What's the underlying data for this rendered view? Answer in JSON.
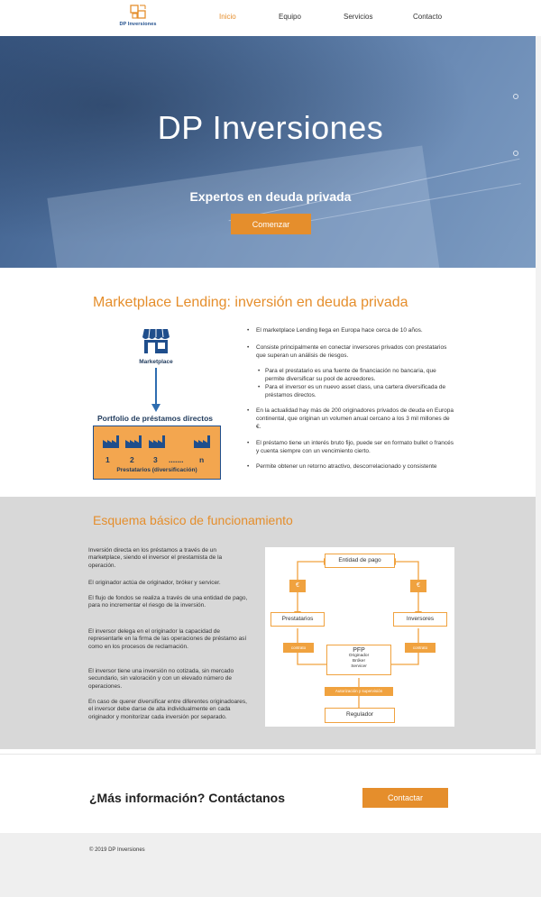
{
  "header": {
    "logo_text": "DP Inversiones",
    "nav": [
      "Inicio",
      "Equipo",
      "Servicios",
      "Contacto"
    ]
  },
  "hero": {
    "title": "DP Inversiones",
    "subtitle": "Expertos en deuda privada",
    "cta": "Comenzar"
  },
  "section1": {
    "title": "Marketplace Lending: inversión en deuda privada",
    "marketplace_label": "Marketplace",
    "portfolio_title": "Portfolio de préstamos directos",
    "portfolio_numbers": [
      "1",
      "2",
      "3",
      ".......",
      "n"
    ],
    "portfolio_caption": "Prestatarios (diversificación)",
    "bullets": [
      "El marketplace Lending llega en Europa hace cerca de 10 años.",
      "Consiste principalmente en conectar inversores privados con prestatarios que superan un análisis de riesgos.",
      "Para el prestatario es una fuente de financiación no bancaria, que permite diversificar su pool de acreedores.",
      "Para el inversor es un nuevo asset class, una cartera diversificada de préstamos directos.",
      "En la actualidad hay más de 200 originadores privados de deuda en Europa continental, que originan un volumen anual cercano a los 3 mil millones de €.",
      "El préstamo tiene un interés bruto fijo, puede ser en formato bullet o francés y cuenta siempre con un vencimiento cierto.",
      "Permite obtener un retorno atractivo, descorrelacionado y consistente"
    ]
  },
  "section2": {
    "title": "Esquema básico de funcionamiento",
    "paragraphs": [
      "Inversión directa en los préstamos a través de un marketplace, siendo el inversor el prestamista de la operación.",
      "El originador actúa de originador, bróker y servicer.",
      "El flujo de fondos se realiza a través de una entidad de pago, para no incrementar el riesgo de la inversión.",
      "El inversor delega en el originador la capacidad de representarle en la firma de las operaciones de préstamo así como en los procesos de reclamación.",
      "El inversor tiene una inversión no cotizada, sin mercado secundario, sin valoración y con un elevado número de operaciones.",
      "En caso de querer diversificar entre diferentes originadoares, el inversor debe darse de alta individualmente en cada originador y monitorizar cada inversión por separado."
    ],
    "diagram": {
      "entidad": "Entidad de pago",
      "euro": "€",
      "prestatarios": "Prestatarios",
      "inversores": "Inversores",
      "contrato": "contrato",
      "pfp": "PFP",
      "pfp_lines": [
        "Originador",
        "Bróker",
        "Servicer"
      ],
      "autorizacion": "Autorización y supervisión",
      "regulador": "Regulador"
    }
  },
  "contact": {
    "title": "¿Más información? Contáctanos",
    "button": "Contactar"
  },
  "footer": {
    "copyright": "© 2019 DP Inversiones"
  },
  "colors": {
    "accent": "#e58e2c",
    "navy": "#1f4e8c",
    "gray_band": "#d8d8d8"
  }
}
